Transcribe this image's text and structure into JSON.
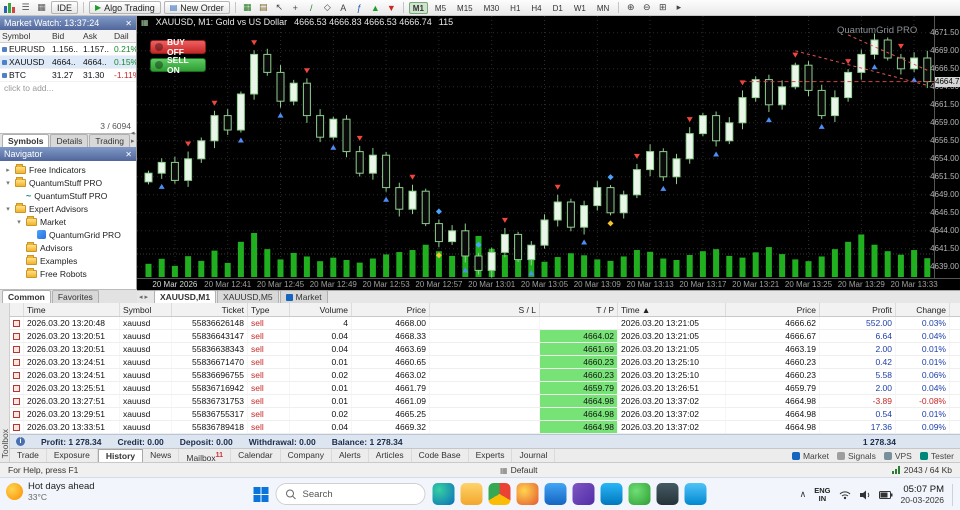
{
  "toolbar": {
    "ide_label": "IDE",
    "algo_trading_label": "Algo Trading",
    "new_order_label": "New Order",
    "icons_left": [
      {
        "name": "mt5-logo-icon",
        "glyph": "logo",
        "color": "#2962ad"
      },
      {
        "name": "menu-icon",
        "glyph": "☰",
        "color": "#555"
      },
      {
        "name": "window-layout-icon",
        "glyph": "▦",
        "color": "#555"
      }
    ],
    "icons_mid": [
      {
        "name": "new-chart-icon",
        "glyph": "▦",
        "color": "#2a7d2a"
      },
      {
        "name": "profiles-icon",
        "glyph": "▤",
        "color": "#7a6a2a"
      },
      {
        "name": "cursor-icon",
        "glyph": "↖",
        "color": "#444"
      },
      {
        "name": "crosshair-icon",
        "glyph": "+",
        "color": "#444"
      },
      {
        "name": "trendline-icon",
        "glyph": "/",
        "color": "#2a7d2a"
      },
      {
        "name": "shapes-icon",
        "glyph": "◇",
        "color": "#444"
      },
      {
        "name": "text-label-icon",
        "glyph": "A",
        "color": "#444"
      },
      {
        "name": "indicators-icon",
        "glyph": "ƒ",
        "color": "#1f5bb5"
      },
      {
        "name": "buy-arrow-icon",
        "glyph": "▲",
        "color": "#1f9d2a"
      },
      {
        "name": "sell-arrow-icon",
        "glyph": "▼",
        "color": "#c62828"
      }
    ],
    "icons_right": [
      {
        "name": "zoom-in-icon",
        "glyph": "⊕",
        "color": "#444"
      },
      {
        "name": "zoom-out-icon",
        "glyph": "⊖",
        "color": "#444"
      },
      {
        "name": "tile-windows-icon",
        "glyph": "⊞",
        "color": "#444"
      },
      {
        "name": "scroll-to-end-icon",
        "glyph": "▸",
        "color": "#444"
      }
    ],
    "timeframes": [
      "M1",
      "M5",
      "M15",
      "M30",
      "H1",
      "H4",
      "D1",
      "W1",
      "MN"
    ],
    "active_timeframe": "M1"
  },
  "market_watch": {
    "title": "Market Watch: 13:37:24",
    "columns": [
      "Symbol",
      "Bid",
      "Ask",
      "Dail"
    ],
    "rows": [
      {
        "symbol": "EURUSD",
        "bid": "1.156..",
        "ask": "1.157..",
        "daily": "0.21%",
        "dir": "up",
        "selected": false
      },
      {
        "symbol": "XAUUSD",
        "bid": "4664..",
        "ask": "4664..",
        "daily": "0.15%",
        "dir": "up",
        "selected": true
      },
      {
        "symbol": "BTC",
        "bid": "31.27",
        "ask": "31.30",
        "daily": "-1.11%",
        "dir": "down",
        "selected": false
      }
    ],
    "add_row_label": "click to add...",
    "counter": "3 / 6094",
    "tabs": [
      {
        "label": "Symbols",
        "active": true
      },
      {
        "label": "Details",
        "active": false
      },
      {
        "label": "Trading",
        "active": false
      }
    ]
  },
  "navigator": {
    "title": "Navigator",
    "tree": [
      {
        "indent": 0,
        "expander": "collapsed",
        "icon": "folder",
        "label": "Free Indicators"
      },
      {
        "indent": 0,
        "expander": "expanded",
        "icon": "folder",
        "label": "QuantumStuff PRO"
      },
      {
        "indent": 1,
        "expander": "none",
        "icon": "indicator",
        "label": "QuantumStuff PRO"
      },
      {
        "indent": 0,
        "expander": "expanded",
        "icon": "folder",
        "label": "Expert Advisors"
      },
      {
        "indent": 1,
        "expander": "expanded",
        "icon": "folder",
        "label": "Market"
      },
      {
        "indent": 2,
        "expander": "none",
        "icon": "ea",
        "label": "QuantumGrid PRO"
      },
      {
        "indent": 1,
        "expander": "none",
        "icon": "folder",
        "label": "Advisors"
      },
      {
        "indent": 1,
        "expander": "none",
        "icon": "folder",
        "label": "Examples"
      },
      {
        "indent": 1,
        "expander": "none",
        "icon": "folder",
        "label": "Free Robots"
      }
    ],
    "tabs": [
      {
        "label": "Common",
        "active": true
      },
      {
        "label": "Favorites",
        "active": false
      }
    ]
  },
  "chart": {
    "title_line": "XAUUSD, M1: Gold vs US Dollar",
    "ohlc": "4666.53 4666.83 4666.53 4666.74",
    "tick_volume": "115",
    "overlay_label": "QuantumGrid PRO",
    "buy_button_label": "BUY OFF",
    "sell_button_label": "SELL ON",
    "current_price_label": "4664.72",
    "tabs": [
      {
        "label": "XAUUSD,M1",
        "active": true,
        "icon": false
      },
      {
        "label": "XAUUSD,M5",
        "active": false,
        "icon": false
      },
      {
        "label": "Market",
        "active": false,
        "icon": true
      }
    ]
  },
  "chart_data": {
    "type": "candlestick",
    "symbol": "XAUUSD",
    "timeframe": "M1",
    "price_max": 4673,
    "price_min": 4638,
    "closes": [
      4652.0,
      4653.5,
      4651.0,
      4654.0,
      4656.5,
      4660.0,
      4658.0,
      4663.0,
      4668.5,
      4666.0,
      4662.0,
      4664.5,
      4660.0,
      4657.0,
      4659.5,
      4655.0,
      4652.0,
      4654.5,
      4650.0,
      4647.0,
      4649.5,
      4645.0,
      4642.5,
      4644.0,
      4640.5,
      4638.5,
      4641.0,
      4643.5,
      4640.0,
      4642.0,
      4645.5,
      4648.0,
      4644.5,
      4647.5,
      4650.0,
      4646.5,
      4649.0,
      4652.5,
      4655.0,
      4651.5,
      4654.0,
      4657.5,
      4660.0,
      4656.5,
      4659.0,
      4662.5,
      4665.0,
      4661.5,
      4664.0,
      4667.0,
      4663.5,
      4660.0,
      4662.5,
      4666.0,
      4668.5,
      4670.5,
      4668.0,
      4666.5,
      4668.0,
      4664.72
    ],
    "volumes": [
      45,
      62,
      38,
      71,
      55,
      90,
      48,
      120,
      150,
      95,
      60,
      82,
      70,
      54,
      66,
      58,
      49,
      63,
      77,
      85,
      92,
      110,
      88,
      72,
      130,
      140,
      96,
      75,
      64,
      58,
      52,
      68,
      81,
      74,
      60,
      55,
      70,
      92,
      86,
      63,
      58,
      75,
      88,
      95,
      72,
      66,
      84,
      102,
      78,
      60,
      54,
      70,
      95,
      120,
      145,
      110,
      88,
      76,
      92,
      64
    ],
    "markers": [
      {
        "i": 1,
        "k": "buy"
      },
      {
        "i": 3,
        "k": "sell"
      },
      {
        "i": 5,
        "k": "sell"
      },
      {
        "i": 7,
        "k": "buy"
      },
      {
        "i": 8,
        "k": "sell"
      },
      {
        "i": 10,
        "k": "buy"
      },
      {
        "i": 12,
        "k": "sell"
      },
      {
        "i": 14,
        "k": "buy"
      },
      {
        "i": 16,
        "k": "sell"
      },
      {
        "i": 18,
        "k": "buy"
      },
      {
        "i": 20,
        "k": "sell"
      },
      {
        "i": 22,
        "k": "diamond"
      },
      {
        "i": 24,
        "k": "buy"
      },
      {
        "i": 25,
        "k": "diamond"
      },
      {
        "i": 27,
        "k": "sell"
      },
      {
        "i": 29,
        "k": "buy"
      },
      {
        "i": 31,
        "k": "sell"
      },
      {
        "i": 33,
        "k": "buy"
      },
      {
        "i": 35,
        "k": "diamond"
      },
      {
        "i": 37,
        "k": "sell"
      },
      {
        "i": 39,
        "k": "buy"
      },
      {
        "i": 41,
        "k": "sell"
      },
      {
        "i": 43,
        "k": "buy"
      },
      {
        "i": 45,
        "k": "sell"
      },
      {
        "i": 47,
        "k": "buy"
      },
      {
        "i": 49,
        "k": "sell"
      },
      {
        "i": 51,
        "k": "buy"
      },
      {
        "i": 53,
        "k": "sell"
      },
      {
        "i": 55,
        "k": "buy"
      },
      {
        "i": 57,
        "k": "sell"
      },
      {
        "i": 58,
        "k": "buy"
      }
    ],
    "trend_lines": [
      {
        "i1": 49,
        "p1": 4669.0,
        "i2": 59,
        "p2": 4664.2
      },
      {
        "i1": 53,
        "p1": 4671.2,
        "i2": 59,
        "p2": 4666.3
      }
    ],
    "current_price": 4664.72,
    "price_labels": [
      "4671.50",
      "4669.00",
      "4666.50",
      "4664.00",
      "4661.50",
      "4659.00",
      "4656.50",
      "4654.00",
      "4651.50",
      "4649.00",
      "4646.50",
      "4644.00",
      "4641.50",
      "4639.00"
    ],
    "time_labels": [
      "20 Mar 2026",
      "20 Mar 12:41",
      "20 Mar 12:45",
      "20 Mar 12:49",
      "20 Mar 12:53",
      "20 Mar 12:57",
      "20 Mar 13:01",
      "20 Mar 13:05",
      "20 Mar 13:09",
      "20 Mar 13:13",
      "20 Mar 13:17",
      "20 Mar 13:21",
      "20 Mar 13:25",
      "20 Mar 13:29",
      "20 Mar 13:33"
    ]
  },
  "history": {
    "columns": [
      "",
      "Time",
      "Symbol",
      "Ticket",
      "Type",
      "Volume",
      "Price",
      "S / L",
      "T / P",
      "Time ▲",
      "Price",
      "Profit",
      "Change"
    ],
    "rows": [
      {
        "open_time": "2026.03.20 13:20:48",
        "symbol": "xauusd",
        "ticket": "55836626148",
        "type": "sell",
        "volume": "4",
        "price": "4668.00",
        "sl": "",
        "tp": "",
        "close_time": "2026.03.20 13:21:05",
        "close_price": "4666.62",
        "profit": "552.00",
        "change": "0.03%",
        "tp_green": false
      },
      {
        "open_time": "2026.03.20 13:20:51",
        "symbol": "xauusd",
        "ticket": "55836643147",
        "type": "sell",
        "volume": "0.04",
        "price": "4668.33",
        "sl": "",
        "tp": "4664.02",
        "close_time": "2026.03.20 13:21:05",
        "close_price": "4666.67",
        "profit": "6.64",
        "change": "0.04%",
        "tp_green": true
      },
      {
        "open_time": "2026.03.20 13:20:51",
        "symbol": "xauusd",
        "ticket": "55836638343",
        "type": "sell",
        "volume": "0.04",
        "price": "4663.69",
        "sl": "",
        "tp": "4661.69",
        "close_time": "2026.03.20 13:21:05",
        "close_price": "4663.19",
        "profit": "2.00",
        "change": "0.01%",
        "tp_green": true
      },
      {
        "open_time": "2026.03.20 13:24:51",
        "symbol": "xauusd",
        "ticket": "55836671470",
        "type": "sell",
        "volume": "0.01",
        "price": "4660.65",
        "sl": "",
        "tp": "4660.23",
        "close_time": "2026.03.20 13:25:10",
        "close_price": "4660.23",
        "profit": "0.42",
        "change": "0.01%",
        "tp_green": true
      },
      {
        "open_time": "2026.03.20 13:24:51",
        "symbol": "xauusd",
        "ticket": "55836696755",
        "type": "sell",
        "volume": "0.02",
        "price": "4663.02",
        "sl": "",
        "tp": "4660.23",
        "close_time": "2026.03.20 13:25:10",
        "close_price": "4660.23",
        "profit": "5.58",
        "change": "0.06%",
        "tp_green": true
      },
      {
        "open_time": "2026.03.20 13:25:51",
        "symbol": "xauusd",
        "ticket": "55836716942",
        "type": "sell",
        "volume": "0.01",
        "price": "4661.79",
        "sl": "",
        "tp": "4659.79",
        "close_time": "2026.03.20 13:26:51",
        "close_price": "4659.79",
        "profit": "2.00",
        "change": "0.04%",
        "tp_green": true
      },
      {
        "open_time": "2026.03.20 13:27:51",
        "symbol": "xauusd",
        "ticket": "55836731753",
        "type": "sell",
        "volume": "0.01",
        "price": "4661.09",
        "sl": "",
        "tp": "4664.98",
        "close_time": "2026.03.20 13:37:02",
        "close_price": "4664.98",
        "profit": "-3.89",
        "change": "-0.08%",
        "tp_green": true
      },
      {
        "open_time": "2026.03.20 13:29:51",
        "symbol": "xauusd",
        "ticket": "55836755317",
        "type": "sell",
        "volume": "0.02",
        "price": "4665.25",
        "sl": "",
        "tp": "4664.98",
        "close_time": "2026.03.20 13:37:02",
        "close_price": "4664.98",
        "profit": "0.54",
        "change": "0.01%",
        "tp_green": true
      },
      {
        "open_time": "2026.03.20 13:33:51",
        "symbol": "xauusd",
        "ticket": "55836789418",
        "type": "sell",
        "volume": "0.04",
        "price": "4669.32",
        "sl": "",
        "tp": "4664.98",
        "close_time": "2026.03.20 13:37:02",
        "close_price": "4664.98",
        "profit": "17.36",
        "change": "0.09%",
        "tp_green": true
      }
    ],
    "summary_segments": [
      "Profit: 1 278.34",
      "Credit: 0.00",
      "Deposit: 0.00",
      "Withdrawal: 0.00",
      "Balance: 1 278.34"
    ],
    "summary_total": "1 278.34"
  },
  "bottom_tabs": {
    "items": [
      {
        "label": "Trade"
      },
      {
        "label": "Exposure"
      },
      {
        "label": "History",
        "active": true
      },
      {
        "label": "News"
      },
      {
        "label": "Mailbox",
        "badge": "11"
      },
      {
        "label": "Calendar"
      },
      {
        "label": "Company"
      },
      {
        "label": "Alerts"
      },
      {
        "label": "Articles"
      },
      {
        "label": "Code Base"
      },
      {
        "label": "Experts"
      },
      {
        "label": "Journal"
      }
    ],
    "right_items": [
      {
        "label": "Market",
        "color": "#1565c0"
      },
      {
        "label": "Signals",
        "color": "#9e9e9e"
      },
      {
        "label": "VPS",
        "color": "#78909c"
      },
      {
        "label": "Tester",
        "color": "#00897b"
      }
    ]
  },
  "status_bar": {
    "help": "For Help, press F1",
    "profile": "Default",
    "traffic": "2043 / 64 Kb"
  },
  "taskbar": {
    "weather_title": "Hot days ahead",
    "weather_temp": "33°C",
    "search_label": "Search",
    "lang_top": "ENG",
    "lang_bottom": "IN",
    "time": "05:07 PM",
    "date": "20-03-2026",
    "app_icons": [
      {
        "name": "taskbar-edge-icon",
        "bg": "radial-gradient(circle at 30% 30%,#35d0a2,#0b6fb8)"
      },
      {
        "name": "taskbar-folder-icon",
        "bg": "linear-gradient(#ffd36b,#f2a72c)"
      },
      {
        "name": "taskbar-chrome-icon",
        "bg": "conic-gradient(#ea4335 0deg 120deg,#fbbc05 120deg 240deg,#34a853 240deg 360deg)"
      },
      {
        "name": "taskbar-firefox-icon",
        "bg": "radial-gradient(circle at 35% 35%,#ffd54f,#e4572e)"
      },
      {
        "name": "taskbar-mail-icon",
        "bg": "linear-gradient(#42a5f5,#1565c0)"
      },
      {
        "name": "taskbar-photos-icon",
        "bg": "linear-gradient(135deg,#7e57c2,#512da8)"
      },
      {
        "name": "taskbar-store-icon",
        "bg": "linear-gradient(#29b6f6,#0277bd)"
      },
      {
        "name": "taskbar-whatsapp-icon",
        "bg": "radial-gradient(circle at 35% 35%,#6fdf75,#2e9e33)"
      },
      {
        "name": "taskbar-obs-icon",
        "bg": "linear-gradient(#455a64,#263238)"
      },
      {
        "name": "taskbar-telegram-icon",
        "bg": "linear-gradient(#4fc3f7,#0288d1)"
      }
    ]
  },
  "toolbox_label": "Toolbox"
}
